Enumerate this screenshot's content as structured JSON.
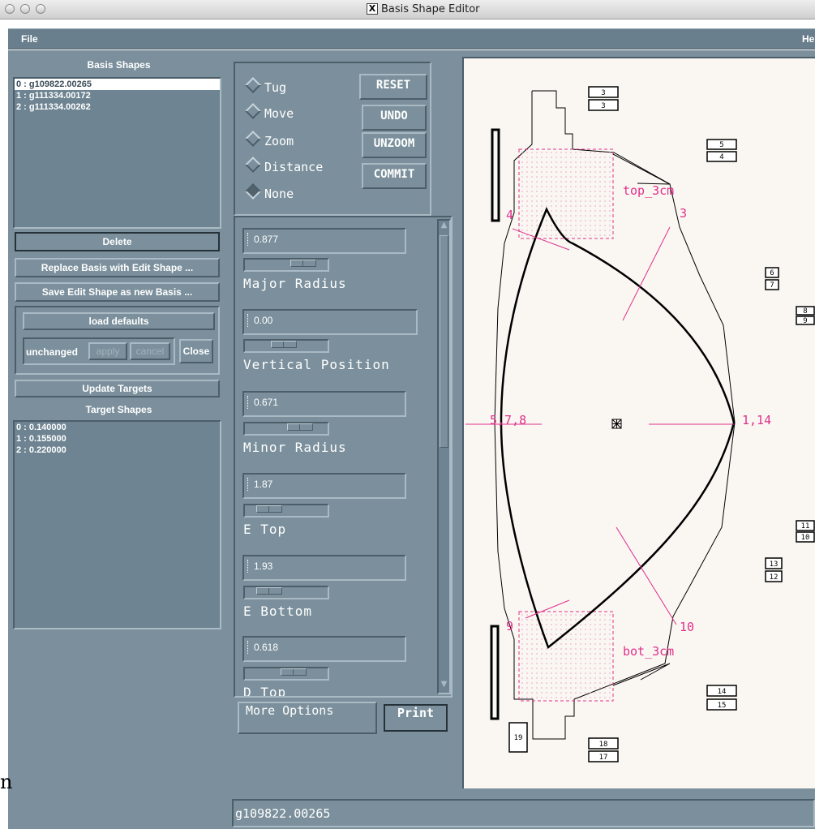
{
  "window": {
    "title": "Basis Shape Editor"
  },
  "menubar": {
    "file": "File",
    "help": "He"
  },
  "left_panel": {
    "basis_title": "Basis Shapes",
    "basis_shapes": [
      "0 : g109822.00265",
      "1 : g111334.00172",
      "2 : g111334.00262"
    ],
    "delete_label": "Delete",
    "replace_label": "Replace Basis with Edit Shape ...",
    "save_label": "Save Edit Shape as new Basis ...",
    "load_defaults_label": "load defaults",
    "status_label": "unchanged",
    "apply_label": "apply",
    "cancel_label": "cancel",
    "close_label": "Close",
    "update_targets_label": "Update Targets",
    "target_title": "Target Shapes",
    "target_shapes": [
      "0 : 0.140000",
      "1 : 0.155000",
      "2 : 0.220000"
    ]
  },
  "modes": {
    "items": [
      "Tug",
      "Move",
      "Zoom",
      "Distance",
      "None"
    ],
    "selected": "None",
    "buttons": {
      "reset": "RESET",
      "undo": "UNDO",
      "unzoom": "UNZOOM",
      "commit": "COMMIT"
    }
  },
  "params": [
    {
      "value": "0.877",
      "label": "Major Radius"
    },
    {
      "value": "0.00",
      "label": "Vertical Position"
    },
    {
      "value": "0.671",
      "label": "Minor Radius"
    },
    {
      "value": "1.87",
      "label": "E Top"
    },
    {
      "value": "1.93",
      "label": "E Bottom"
    },
    {
      "value": "0.618",
      "label": "D Top"
    }
  ],
  "bottom_buttons": {
    "more_options": "More  Options",
    "print": "Print"
  },
  "status_bar": {
    "text": "g109822.00265"
  },
  "canvas": {
    "box_labels": [
      "3",
      "3",
      "5",
      "4",
      "6",
      "7",
      "8",
      "9",
      "11",
      "10",
      "13",
      "12",
      "14",
      "15",
      "18",
      "17",
      "19"
    ],
    "region_labels": {
      "top": "top_3cm",
      "bottom": "bot_3cm"
    },
    "ray_labels": {
      "r3": "3",
      "r4": "4",
      "left": "5,7,8",
      "right": "1,14",
      "r9": "9",
      "r10": "10"
    },
    "colors": {
      "accent": "#e0308a",
      "outline": "#000000",
      "background": "#faf7f3"
    }
  },
  "stray_text": "n"
}
